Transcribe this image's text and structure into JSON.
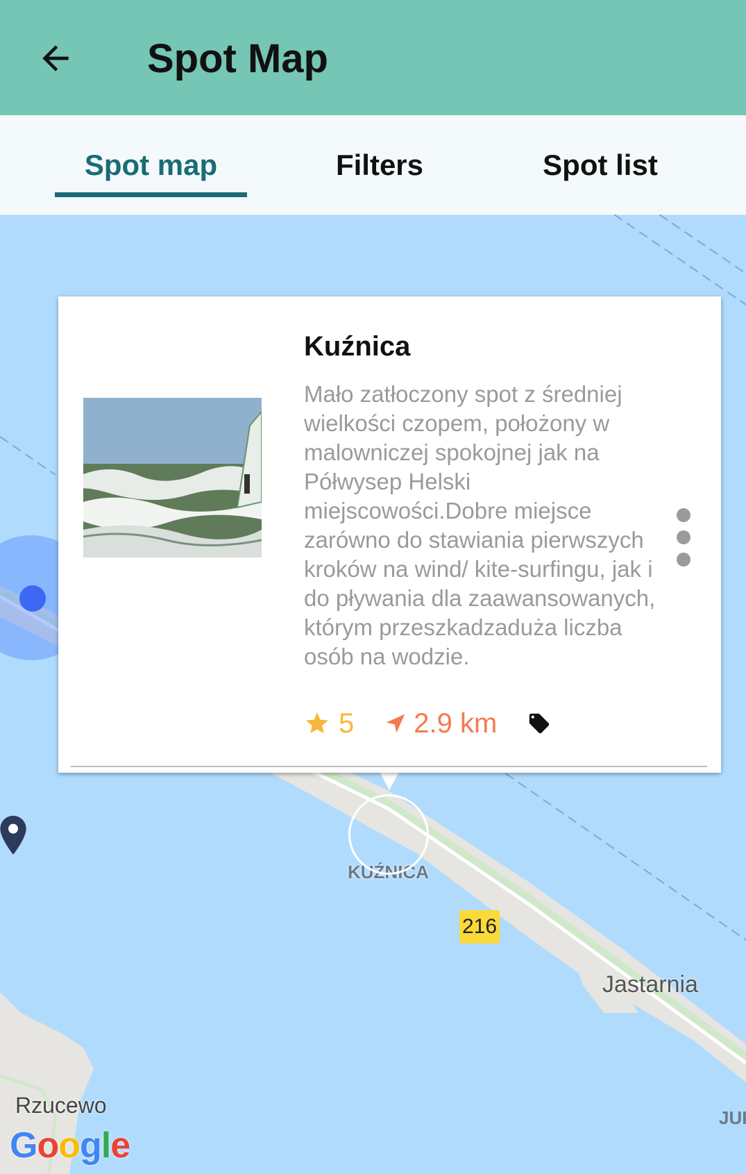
{
  "appbar": {
    "title": "Spot Map",
    "back_icon": "arrow-left-icon"
  },
  "tabs": [
    {
      "label": "Spot map",
      "active": true
    },
    {
      "label": "Filters",
      "active": false
    },
    {
      "label": "Spot list",
      "active": false
    }
  ],
  "map": {
    "labels": {
      "kuznica": "KUŹNICA",
      "jastarnia": "Jastarnia",
      "rzucewo": "Rzucewo",
      "jur": "JUR"
    },
    "road_number": "216",
    "provider": {
      "letters": [
        "G",
        "o",
        "o",
        "g",
        "l",
        "e"
      ],
      "colors": [
        "#4285F4",
        "#EA4335",
        "#FBBC05",
        "#4285F4",
        "#34A853",
        "#EA4335"
      ]
    }
  },
  "spot_card": {
    "title": "Kuźnica",
    "description": "Mało zatłoczony spot z średniej wielkości czopem, położony w malowniczej spokojnej jak na Półwysep Helski miejscowości.Dobre miejsce zarówno do stawiania pierwszych kroków na wind/ kite-surfingu, jak i do pływania dla zaawansowanych, którym przeszkadzaduża liczba osób na wodzie.",
    "rating": "5",
    "distance": "2.9 km",
    "icons": {
      "rating": "star-icon",
      "distance": "navigation-arrow-icon",
      "tag": "tag-icon",
      "menu": "more-vertical-icon"
    },
    "colors": {
      "rating": "#f8b53b",
      "distance": "#f47a50"
    }
  },
  "colors": {
    "appbar": "#75c6b5",
    "tab_active": "#196c76",
    "water": "#b0dbfd"
  }
}
